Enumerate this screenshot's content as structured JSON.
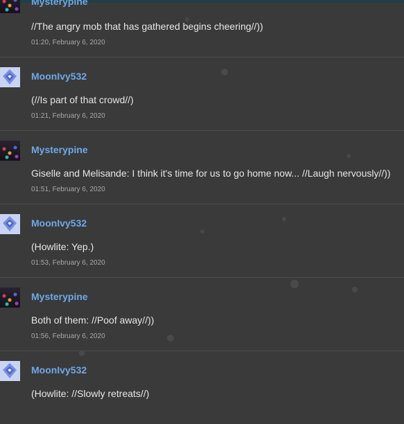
{
  "messages": [
    {
      "user": "Mysterypine",
      "avatar": "mysterypine-avatar",
      "text": "//The angry mob that has gathered begins cheering//))",
      "time": "01:20, February 6, 2020"
    },
    {
      "user": "MoonIvy532",
      "avatar": "moonivy-avatar",
      "text": "(//Is part of that crowd//)",
      "time": "01:21, February 6, 2020"
    },
    {
      "user": "Mysterypine",
      "avatar": "mysterypine-avatar",
      "text": "Giselle and Melisande: I think it's time for us to go home now... //Laugh nervously//))",
      "time": "01:51, February 6, 2020"
    },
    {
      "user": "MoonIvy532",
      "avatar": "moonivy-avatar",
      "text": "(Howlite: Yep.)",
      "time": "01:53, February 6, 2020"
    },
    {
      "user": "Mysterypine",
      "avatar": "mysterypine-avatar",
      "text": "Both of them: //Poof away//))",
      "time": "01:56, February 6, 2020"
    },
    {
      "user": "MoonIvy532",
      "avatar": "moonivy-avatar",
      "text": "(Howlite: //Slowly retreats//)",
      "time": ""
    }
  ],
  "colors": {
    "background": "#3a3a3b",
    "username": "#6fa8e6",
    "text": "#e6e6e6",
    "timestamp": "#a9a9a9",
    "divider": "#4d4d4f"
  }
}
